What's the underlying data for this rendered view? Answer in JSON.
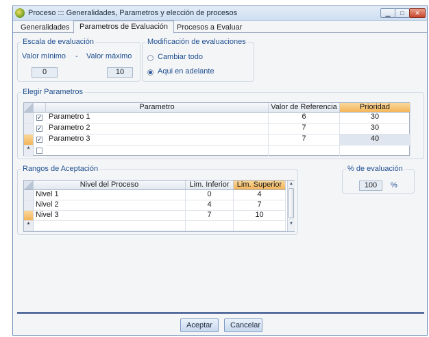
{
  "window": {
    "title": "Proceso ::: Generalidades, Parametros y elección de procesos"
  },
  "tabs": [
    "Generalidades",
    "Parametros de Evaluación",
    "Procesos a Evaluar"
  ],
  "escala": {
    "legend": "Escala de evaluación",
    "min_label": "Valor mínimo",
    "dash": "-",
    "max_label": "Valor máximo",
    "min_value": "0",
    "max_value": "10"
  },
  "modificacion": {
    "legend": "Modificación de evaluaciones",
    "option1": "Cambiar todo",
    "option2": "Aqui en adelante",
    "selected": "Aqui en adelante"
  },
  "parametros": {
    "legend": "Elegir Parametros",
    "columns": [
      "Parametro",
      "Valor de Referencia",
      "Prioridad"
    ],
    "rows": [
      {
        "name": "Parametro 1",
        "ref": "6",
        "prio": "30",
        "checked": true
      },
      {
        "name": "Parametro 2",
        "ref": "7",
        "prio": "30",
        "checked": true
      },
      {
        "name": "Parametro 3",
        "ref": "7",
        "prio": "40",
        "checked": true
      }
    ],
    "new_row_marker": "*"
  },
  "rangos": {
    "legend": "Rangos de Aceptación",
    "columns": [
      "Nivel del Proceso",
      "Lim. Inferior",
      "Lim. Superior"
    ],
    "rows": [
      {
        "name": "Nivel 1",
        "inf": "0",
        "sup": "4"
      },
      {
        "name": "Nivel 2",
        "inf": "4",
        "sup": "7"
      },
      {
        "name": "Nivel 3",
        "inf": "7",
        "sup": "10"
      }
    ],
    "new_row_marker": "*"
  },
  "porcentaje": {
    "legend": "% de evaluación",
    "value": "100",
    "unit": "%"
  },
  "buttons": {
    "accept": "Aceptar",
    "cancel": "Cancelar"
  }
}
